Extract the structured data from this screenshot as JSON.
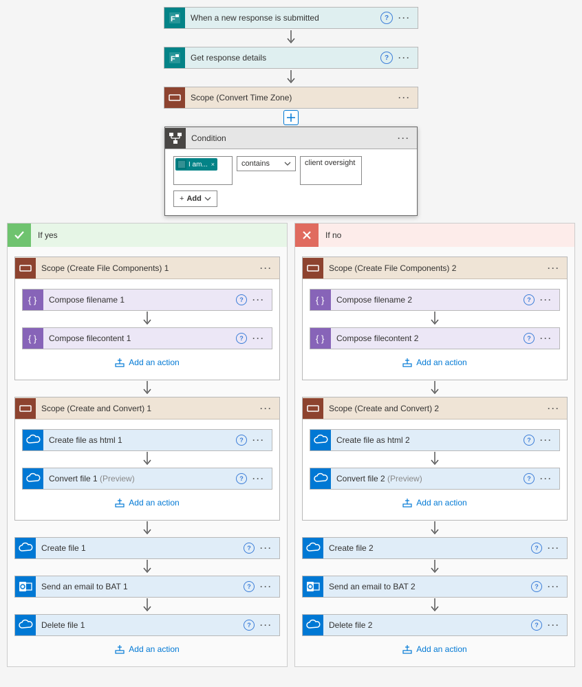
{
  "top": {
    "trigger": "When a new response is submitted",
    "get_details": "Get response details",
    "scope_tz": "Scope (Convert Time Zone)"
  },
  "condition": {
    "title": "Condition",
    "token_label": "I am...",
    "token_close": "×",
    "operator": "contains",
    "value": "client oversight",
    "add_label": "Add"
  },
  "branches": {
    "yes": {
      "label": "If yes",
      "scope1": {
        "title": "Scope (Create File Components) 1",
        "compose_filename": "Compose filename 1",
        "compose_filecontent": "Compose filecontent 1"
      },
      "scope2": {
        "title": "Scope (Create and Convert) 1",
        "create_html": "Create file as html 1",
        "convert_file": "Convert file 1",
        "convert_preview": " (Preview)"
      },
      "create_file": "Create file 1",
      "send_email": "Send an email to BAT 1",
      "delete_file": "Delete file 1"
    },
    "no": {
      "label": "If no",
      "scope1": {
        "title": "Scope (Create File Components) 2",
        "compose_filename": "Compose filename 2",
        "compose_filecontent": "Compose filecontent 2"
      },
      "scope2": {
        "title": "Scope (Create and Convert) 2",
        "create_html": "Create file as html 2",
        "convert_file": "Convert file 2",
        "convert_preview": " (Preview)"
      },
      "create_file": "Create file 2",
      "send_email": "Send an email to BAT 2",
      "delete_file": "Delete file 2"
    }
  },
  "common": {
    "add_action": "Add an action",
    "help_glyph": "?",
    "menu_glyph": "···"
  }
}
